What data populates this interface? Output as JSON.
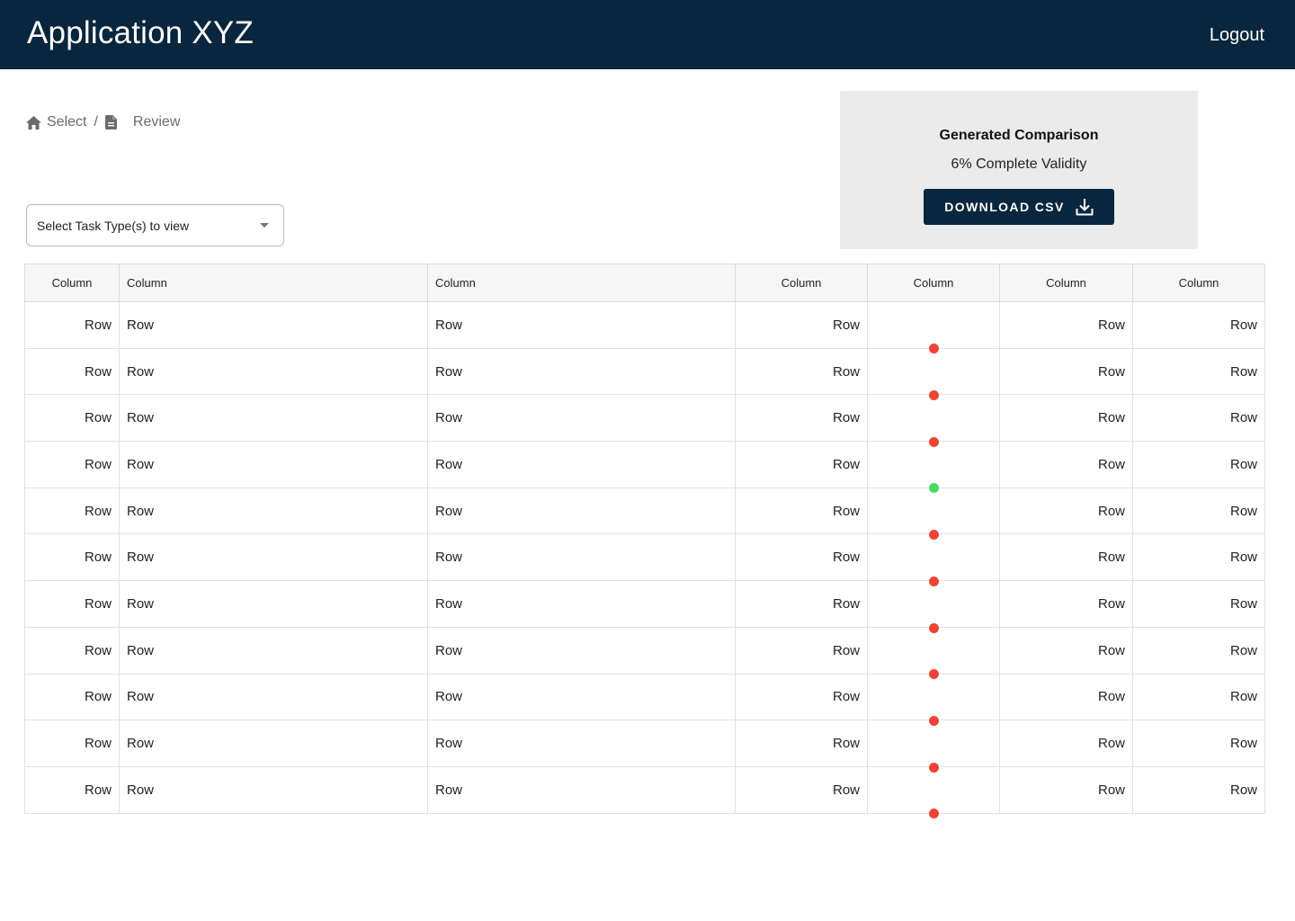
{
  "app": {
    "title": "Application XYZ",
    "logout_label": "Logout"
  },
  "breadcrumb": {
    "items": [
      {
        "label": "Select",
        "icon": "home-icon"
      },
      {
        "label": "Review",
        "icon": "document-icon"
      }
    ],
    "separator": "/"
  },
  "filter": {
    "label": "Select Task Type(s) to view"
  },
  "summary": {
    "title": "Generated Comparison",
    "validity": "6% Complete Validity",
    "download_label": "DOWNLOAD CSV",
    "download_icon": "download-icon"
  },
  "colors": {
    "header_bg": "#08263d",
    "status_invalid": "#f44336",
    "status_valid": "#4cd964"
  },
  "table": {
    "columns": [
      {
        "label": "Column",
        "align": "center"
      },
      {
        "label": "Column",
        "align": "left"
      },
      {
        "label": "Column",
        "align": "left"
      },
      {
        "label": "Column",
        "align": "right"
      },
      {
        "label": "Column",
        "align": "center"
      },
      {
        "label": "Column",
        "align": "center"
      },
      {
        "label": "Column",
        "align": "center"
      }
    ],
    "rows": [
      {
        "c1": "Row",
        "c2": "Row",
        "c3": "Row",
        "c4": "Row",
        "status": "invalid",
        "c6": "Row",
        "c7": "Row"
      },
      {
        "c1": "Row",
        "c2": "Row",
        "c3": "Row",
        "c4": "Row",
        "status": "invalid",
        "c6": "Row",
        "c7": "Row"
      },
      {
        "c1": "Row",
        "c2": "Row",
        "c3": "Row",
        "c4": "Row",
        "status": "invalid",
        "c6": "Row",
        "c7": "Row"
      },
      {
        "c1": "Row",
        "c2": "Row",
        "c3": "Row",
        "c4": "Row",
        "status": "valid",
        "c6": "Row",
        "c7": "Row"
      },
      {
        "c1": "Row",
        "c2": "Row",
        "c3": "Row",
        "c4": "Row",
        "status": "invalid",
        "c6": "Row",
        "c7": "Row"
      },
      {
        "c1": "Row",
        "c2": "Row",
        "c3": "Row",
        "c4": "Row",
        "status": "invalid",
        "c6": "Row",
        "c7": "Row"
      },
      {
        "c1": "Row",
        "c2": "Row",
        "c3": "Row",
        "c4": "Row",
        "status": "invalid",
        "c6": "Row",
        "c7": "Row"
      },
      {
        "c1": "Row",
        "c2": "Row",
        "c3": "Row",
        "c4": "Row",
        "status": "invalid",
        "c6": "Row",
        "c7": "Row"
      },
      {
        "c1": "Row",
        "c2": "Row",
        "c3": "Row",
        "c4": "Row",
        "status": "invalid",
        "c6": "Row",
        "c7": "Row"
      },
      {
        "c1": "Row",
        "c2": "Row",
        "c3": "Row",
        "c4": "Row",
        "status": "invalid",
        "c6": "Row",
        "c7": "Row"
      },
      {
        "c1": "Row",
        "c2": "Row",
        "c3": "Row",
        "c4": "Row",
        "status": "invalid",
        "c6": "Row",
        "c7": "Row"
      }
    ]
  }
}
